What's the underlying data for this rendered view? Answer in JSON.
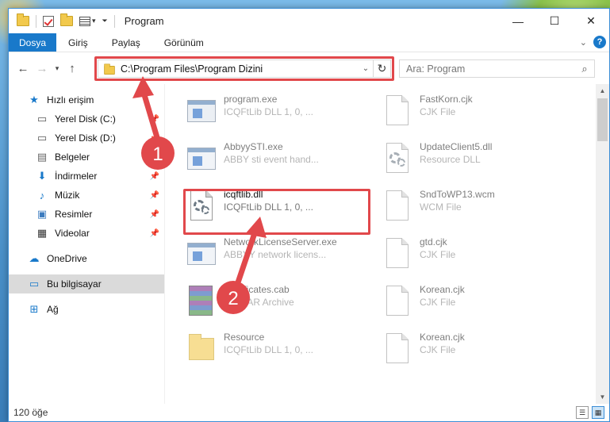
{
  "window": {
    "title": "Program",
    "controls": {
      "minimize": "—",
      "maximize": "☐",
      "close": "✕"
    }
  },
  "ribbon": {
    "tabs": [
      "Dosya",
      "Giriş",
      "Paylaş",
      "Görünüm"
    ],
    "help": "?"
  },
  "navigation": {
    "back": "←",
    "forward": "→",
    "recent": "▾",
    "up": "↑",
    "address": "C:\\Program Files\\Program Dizini",
    "address_dropdown": "⌄",
    "refresh": "↻",
    "search_placeholder": "Ara: Program",
    "search_icon": "⌕"
  },
  "sidebar": {
    "quick_access": "Hızlı erişim",
    "items": [
      {
        "label": "Yerel Disk (C:)",
        "icon": "drive-icon",
        "pinned": true
      },
      {
        "label": "Yerel Disk (D:)",
        "icon": "drive-icon",
        "pinned": true
      },
      {
        "label": "Belgeler",
        "icon": "documents-icon",
        "pinned": true
      },
      {
        "label": "İndirmeler",
        "icon": "download-icon",
        "pinned": true
      },
      {
        "label": "Müzik",
        "icon": "music-icon",
        "pinned": true
      },
      {
        "label": "Resimler",
        "icon": "pictures-icon",
        "pinned": true
      },
      {
        "label": "Videolar",
        "icon": "videos-icon",
        "pinned": true
      }
    ],
    "onedrive": "OneDrive",
    "this_pc": "Bu bilgisayar",
    "network": "Ağ"
  },
  "files": [
    {
      "name": "program.exe",
      "desc": "ICQFtLib DLL 1, 0, ...",
      "icon": "installer-icon"
    },
    {
      "name": "FastKorn.cjk",
      "desc": "CJK File",
      "icon": "blank-file-icon"
    },
    {
      "name": "AbbyySTI.exe",
      "desc": "ABBY sti event hand...",
      "icon": "exe-icon"
    },
    {
      "name": "UpdateClient5.dll",
      "desc": "Resource DLL",
      "icon": "dll-icon"
    },
    {
      "name": "icqftlib.dll",
      "desc": "ICQFtLib DLL 1, 0, ...",
      "icon": "dll-icon"
    },
    {
      "name": "SndToWP13.wcm",
      "desc": "WCM File",
      "icon": "blank-file-icon"
    },
    {
      "name": "NetworkLicenseServer.exe",
      "desc": "ABBYY network licens...",
      "icon": "exe-icon"
    },
    {
      "name": "gtd.cjk",
      "desc": "CJK File",
      "icon": "blank-file-icon"
    },
    {
      "name": "Certificates.cab",
      "desc": "WinRAR Archive",
      "icon": "winrar-icon"
    },
    {
      "name": "Korean.cjk",
      "desc": "CJK File",
      "icon": "blank-file-icon"
    },
    {
      "name": "Resource",
      "desc": "ICQFtLib DLL 1, 0, ...",
      "icon": "folder-icon"
    },
    {
      "name": "Korean.cjk",
      "desc": "CJK File",
      "icon": "blank-file-icon"
    }
  ],
  "status": {
    "count": "120 öğe"
  },
  "annotations": {
    "step1": "1",
    "step2": "2",
    "highlight_color": "#e1484b"
  },
  "colors": {
    "accent": "#1979ca",
    "annotation": "#e1484b"
  }
}
